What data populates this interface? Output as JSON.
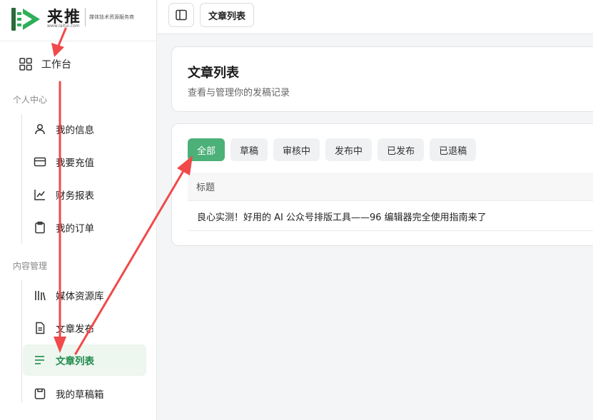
{
  "brand": {
    "name": "来推",
    "url": "www.laitui.com",
    "tagline": "媒体技术资源服务商",
    "colors": {
      "logo_green": "#2fae5a",
      "logo_dark": "#2a6b3b"
    }
  },
  "sidebar": {
    "top_item": {
      "label": "工作台",
      "icon": "grid-icon"
    },
    "sections": [
      {
        "title": "个人中心",
        "items": [
          {
            "label": "我的信息",
            "icon": "user-icon"
          },
          {
            "label": "我要充值",
            "icon": "credit-card-icon"
          },
          {
            "label": "财务报表",
            "icon": "chart-line-icon"
          },
          {
            "label": "我的订单",
            "icon": "clipboard-icon"
          }
        ]
      },
      {
        "title": "内容管理",
        "items": [
          {
            "label": "媒体资源库",
            "icon": "library-icon"
          },
          {
            "label": "文章发布",
            "icon": "file-text-icon"
          },
          {
            "label": "文章列表",
            "icon": "list-icon",
            "active": true
          },
          {
            "label": "我的草稿箱",
            "icon": "draft-box-icon"
          }
        ]
      }
    ]
  },
  "topbar": {
    "toggle_icon": "sidebar-toggle-icon",
    "current_page": "文章列表"
  },
  "header_card": {
    "title": "文章列表",
    "subtitle": "查看与管理你的发稿记录"
  },
  "list_card": {
    "tabs": [
      {
        "label": "全部",
        "active": true
      },
      {
        "label": "草稿"
      },
      {
        "label": "审核中"
      },
      {
        "label": "发布中"
      },
      {
        "label": "已发布"
      },
      {
        "label": "已退稿"
      }
    ],
    "table": {
      "columns": [
        "标题"
      ],
      "rows": [
        {
          "title": "良心实测！好用的 AI 公众号排版工具——96 编辑器完全使用指南来了"
        }
      ]
    }
  },
  "theme": {
    "accent": "#4cb079",
    "active_text": "#1e8a4a",
    "active_bg": "#edf6ef",
    "annotation_red": "#f04a4a"
  }
}
